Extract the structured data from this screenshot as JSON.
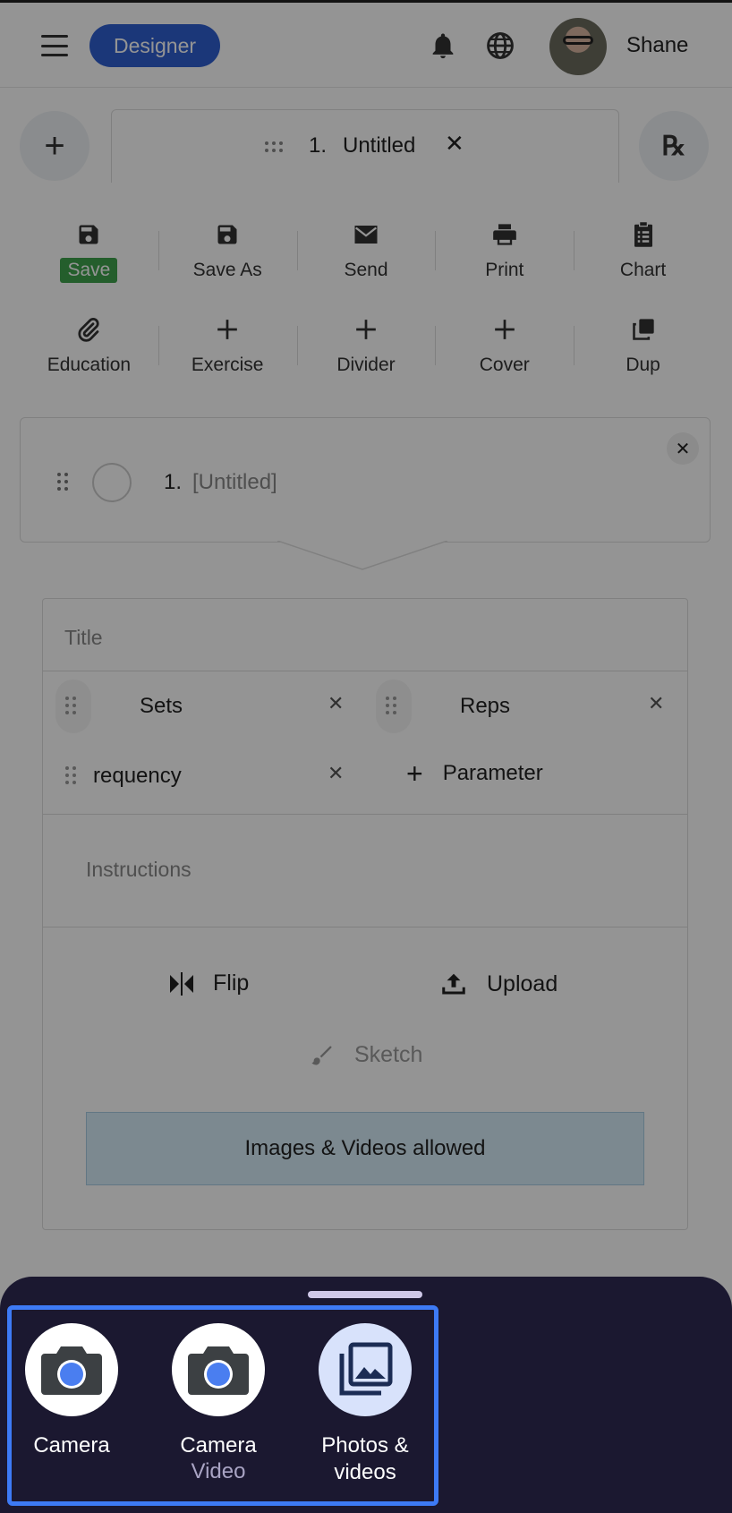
{
  "header": {
    "role_label": "Designer",
    "user_name": "Shane"
  },
  "tab": {
    "number": "1.",
    "title": "Untitled",
    "close_glyph": "✕",
    "add_glyph": "+",
    "rx_glyph": "℞"
  },
  "toolbar": {
    "row1": [
      {
        "label": "Save",
        "icon": "save-icon"
      },
      {
        "label": "Save As",
        "icon": "save-icon"
      },
      {
        "label": "Send",
        "icon": "mail-icon"
      },
      {
        "label": "Print",
        "icon": "printer-icon"
      },
      {
        "label": "Chart",
        "icon": "clipboard-icon"
      }
    ],
    "row2": [
      {
        "label": "Education",
        "icon": "paperclip-icon"
      },
      {
        "label": "Exercise",
        "icon": "plus-icon"
      },
      {
        "label": "Divider",
        "icon": "plus-icon"
      },
      {
        "label": "Cover",
        "icon": "plus-icon"
      },
      {
        "label": "Dup",
        "icon": "duplicate-icon"
      }
    ]
  },
  "item": {
    "number": "1.",
    "title": "[Untitled]",
    "close_glyph": "✕"
  },
  "form": {
    "title_placeholder": "Title",
    "params": [
      {
        "name": "Sets"
      },
      {
        "name": "Reps"
      },
      {
        "name": "requency"
      }
    ],
    "add_param_label": "Parameter",
    "instructions_placeholder": "Instructions",
    "flip_label": "Flip",
    "upload_label": "Upload",
    "sketch_label": "Sketch",
    "dropzone_label": "Images & Videos allowed"
  },
  "picker": {
    "options": [
      {
        "label": "Camera",
        "sub": "",
        "icon": "camera-icon"
      },
      {
        "label": "Camera",
        "sub": "Video",
        "icon": "camera-icon"
      },
      {
        "label": "Photos &",
        "label2": "videos",
        "icon": "photo-library-icon"
      }
    ]
  },
  "colors": {
    "accent": "#2f5fd0",
    "save_green": "#3fa34d",
    "sheet_bg": "#1b1830",
    "highlight": "#3d7af5"
  }
}
